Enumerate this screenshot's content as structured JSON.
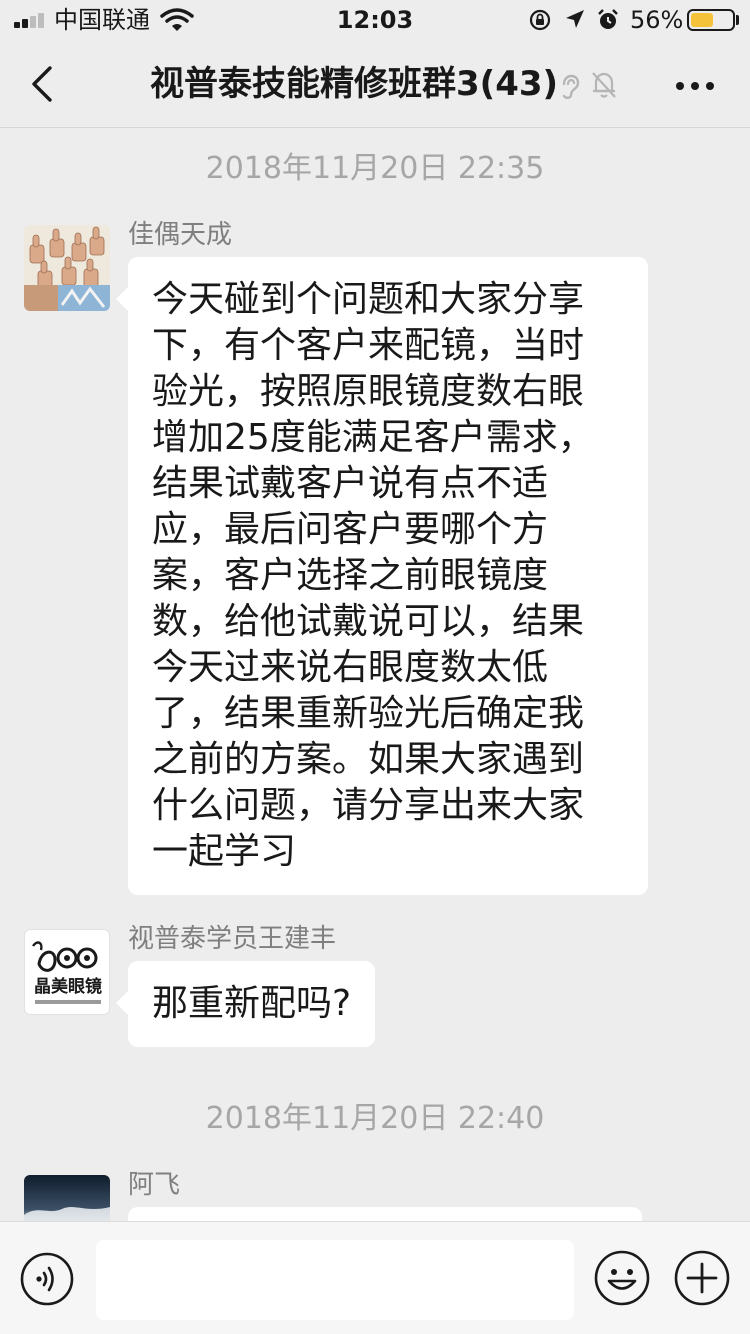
{
  "status_bar": {
    "carrier": "中国联通",
    "time": "12:03",
    "battery_percent_label": "56%",
    "battery_level": 0.56,
    "battery_color": "#f5c33b"
  },
  "nav": {
    "title": "视普泰技能精修班群3(43)",
    "icons": [
      "back-chevron-icon",
      "ear-icon",
      "mute-bell-icon",
      "more-dots-icon"
    ]
  },
  "chat": {
    "messages": [
      {
        "timestamp": "2018年11月20日 22:35",
        "sender": "佳偶天成",
        "avatar": "thumbs-up-avatar",
        "lines": [
          "今天碰到个问题和大家分享",
          "下，有个客户来配镜，当时",
          "验光，按照原眼镜度数右眼",
          "增加25度能满足客户需求，",
          "结果试戴客户说有点不适",
          "应，最后问客户要哪个方",
          "案，客户选择之前眼镜度",
          "数，给他试戴说可以，结果",
          "今天过来说右眼度数太低",
          "了，结果重新验光后确定我",
          "之前的方案。如果大家遇到",
          "什么问题，请分享出来大家",
          "一起学习"
        ]
      },
      {
        "sender": "视普泰学员王建丰",
        "avatar": "optical-shop-logo-avatar",
        "avatar_text": "晶美眼镜",
        "lines": [
          "那重新配吗?"
        ]
      },
      {
        "timestamp": "2018年11月20日 22:40",
        "sender": "阿飞",
        "avatar": "sky-landscape-avatar",
        "lines": []
      }
    ]
  },
  "input_bar": {
    "value": "",
    "icons": [
      "voice-icon",
      "emoji-icon",
      "plus-icon"
    ]
  }
}
